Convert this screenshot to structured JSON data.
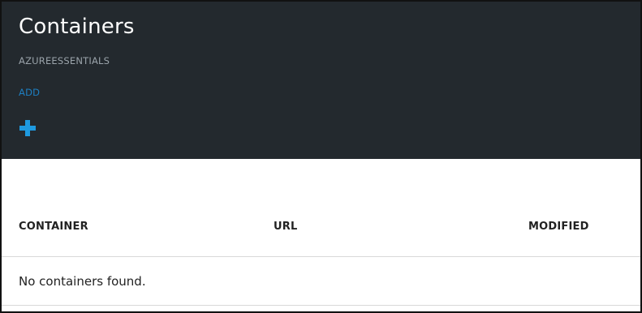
{
  "blade": {
    "title": "Containers",
    "subtitle": "AZUREESSENTIALS",
    "add_label": "ADD",
    "add_icon": "plus-icon",
    "header_bg": "#23292e",
    "accent": "#1e9ae0"
  },
  "table": {
    "columns": [
      "CONTAINER",
      "URL",
      "MODIFIED"
    ],
    "empty_message": "No containers found."
  }
}
